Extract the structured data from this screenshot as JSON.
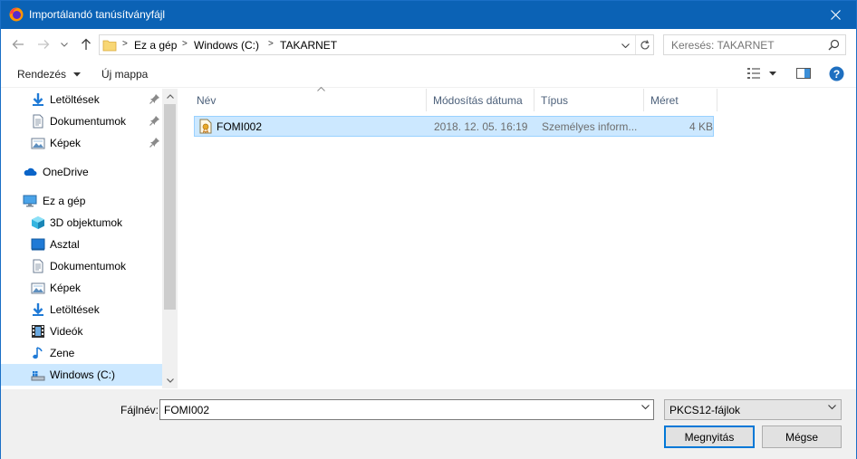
{
  "window": {
    "title": "Importálandó tanúsítványfájl"
  },
  "address": {
    "crumbs": [
      "Ez a gép",
      "Windows (C:)",
      "TAKARNET"
    ]
  },
  "search": {
    "placeholder": "Keresés: TAKARNET"
  },
  "toolbar": {
    "organize_label": "Rendezés",
    "new_folder_label": "Új mappa"
  },
  "nav": {
    "quick_access": [
      {
        "label": "Letöltések",
        "icon": "download-icon",
        "pinned": true
      },
      {
        "label": "Dokumentumok",
        "icon": "document-icon",
        "pinned": true
      },
      {
        "label": "Képek",
        "icon": "pictures-icon",
        "pinned": true
      }
    ],
    "onedrive": {
      "label": "OneDrive",
      "icon": "cloud-icon"
    },
    "this_pc": {
      "label": "Ez a gép",
      "icon": "computer-icon"
    },
    "pc_items": [
      {
        "label": "3D objektumok",
        "icon": "3d-objects-icon"
      },
      {
        "label": "Asztal",
        "icon": "desktop-icon"
      },
      {
        "label": "Dokumentumok",
        "icon": "document-icon"
      },
      {
        "label": "Képek",
        "icon": "pictures-icon"
      },
      {
        "label": "Letöltések",
        "icon": "download-icon"
      },
      {
        "label": "Videók",
        "icon": "videos-icon"
      },
      {
        "label": "Zene",
        "icon": "music-icon"
      },
      {
        "label": "Windows (C:)",
        "icon": "drive-icon",
        "selected": true
      }
    ]
  },
  "columns": {
    "name": "Név",
    "modified": "Módosítás dátuma",
    "type": "Típus",
    "size": "Méret"
  },
  "files": [
    {
      "name": "FOMI002",
      "modified": "2018. 12. 05. 16:19",
      "type": "Személyes inform...",
      "size": "4 KB",
      "icon": "certificate-file-icon",
      "selected": true
    }
  ],
  "footer": {
    "filename_label": "Fájlnév:",
    "filename_value": "FOMI002",
    "filetype_value": "PKCS12-fájlok",
    "open_label": "Megnyitás",
    "cancel_label": "Mégse"
  },
  "colors": {
    "titlebar": "#0b62b5",
    "selection": "#cce8ff",
    "accent": "#0078d7"
  }
}
